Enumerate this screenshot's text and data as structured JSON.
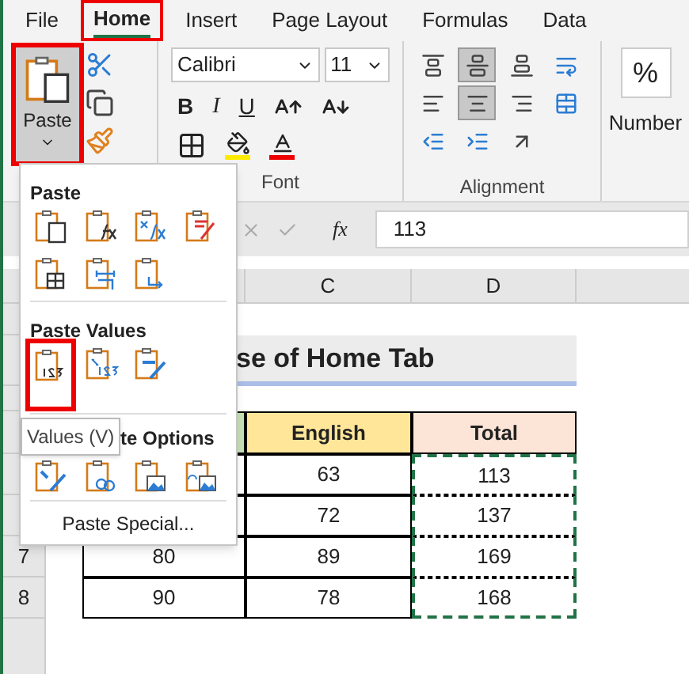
{
  "tabs": [
    {
      "label": "File",
      "selected": false,
      "highlighted": false
    },
    {
      "label": "Home",
      "selected": true,
      "highlighted": true
    },
    {
      "label": "Insert",
      "selected": false,
      "highlighted": false
    },
    {
      "label": "Page Layout",
      "selected": false,
      "highlighted": false
    },
    {
      "label": "Formulas",
      "selected": false,
      "highlighted": false
    },
    {
      "label": "Data",
      "selected": false,
      "highlighted": false
    }
  ],
  "clipboard": {
    "paste_label": "Paste",
    "highlighted": true
  },
  "font": {
    "name": "Calibri",
    "size": "11",
    "bold": "B",
    "italic": "I",
    "underline": "U",
    "group_label": "Font"
  },
  "alignment": {
    "group_label": "Alignment",
    "buttons": [
      {
        "kind": "top",
        "selected": false
      },
      {
        "kind": "middle",
        "selected": true
      },
      {
        "kind": "bottom",
        "selected": false
      },
      {
        "kind": "wrap",
        "selected": false
      },
      {
        "kind": "left",
        "selected": false
      },
      {
        "kind": "center",
        "selected": true
      },
      {
        "kind": "right",
        "selected": false
      },
      {
        "kind": "merge",
        "selected": false
      },
      {
        "kind": "outdent",
        "selected": false
      },
      {
        "kind": "indent",
        "selected": false
      },
      {
        "kind": "orient",
        "selected": false
      }
    ]
  },
  "number": {
    "symbol": "%",
    "label": "Number"
  },
  "formula_bar": {
    "fx": "fx",
    "value": "113"
  },
  "column_headers": [
    "C",
    "D"
  ],
  "title": "se of Home Tab",
  "table": {
    "headers": [
      {
        "color": "#c6e0b4"
      },
      {
        "text": "English",
        "color": "#ffe699"
      },
      {
        "text": "Total",
        "color": "#fce4d6"
      }
    ],
    "total_copied": true,
    "rows": [
      {
        "english": "63",
        "total": "113"
      },
      {
        "english": "72",
        "total": "137"
      },
      {
        "row_number": "7",
        "column_b": "80",
        "english": "89",
        "total": "169"
      },
      {
        "row_number": "8",
        "column_b": "90",
        "english": "78",
        "total": "168"
      }
    ]
  },
  "paste_menu": {
    "sections": [
      {
        "title": "Paste",
        "options": [
          {
            "kind": "all",
            "highlighted": false
          },
          {
            "kind": "formula",
            "highlighted": false
          },
          {
            "kind": "formula-number",
            "highlighted": false
          },
          {
            "kind": "keep-format",
            "highlighted": false
          },
          {
            "kind": "no-borders",
            "highlighted": false
          },
          {
            "kind": "widths",
            "highlighted": false
          },
          {
            "kind": "transpose",
            "highlighted": false
          }
        ]
      },
      {
        "title": "Paste Values",
        "options": [
          {
            "kind": "values",
            "highlighted": true
          },
          {
            "kind": "values-number",
            "highlighted": false
          },
          {
            "kind": "values-format",
            "highlighted": false
          }
        ]
      },
      {
        "title": "te Options",
        "options": [
          {
            "kind": "formatting",
            "highlighted": false
          },
          {
            "kind": "link",
            "highlighted": false
          },
          {
            "kind": "picture",
            "highlighted": false
          },
          {
            "kind": "linked-picture",
            "highlighted": false
          }
        ]
      }
    ],
    "special": "Paste Special...",
    "tooltip": "Values (V)"
  }
}
